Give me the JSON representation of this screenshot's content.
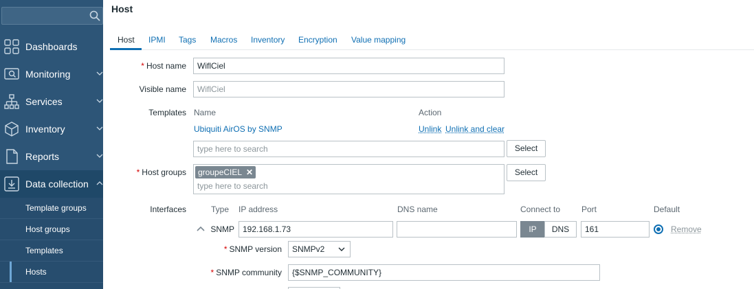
{
  "sidebar": {
    "search_placeholder": "",
    "items": [
      {
        "label": "Dashboards",
        "icon": "dashboard-icon"
      },
      {
        "label": "Monitoring",
        "icon": "monitoring-icon"
      },
      {
        "label": "Services",
        "icon": "services-icon"
      },
      {
        "label": "Inventory",
        "icon": "inventory-icon"
      },
      {
        "label": "Reports",
        "icon": "reports-icon"
      },
      {
        "label": "Data collection",
        "icon": "data-collection-icon"
      }
    ],
    "subitems": [
      {
        "label": "Template groups"
      },
      {
        "label": "Host groups"
      },
      {
        "label": "Templates"
      },
      {
        "label": "Hosts"
      }
    ]
  },
  "page": {
    "title": "Host"
  },
  "tabs": [
    "Host",
    "IPMI",
    "Tags",
    "Macros",
    "Inventory",
    "Encryption",
    "Value mapping"
  ],
  "form": {
    "host_name": {
      "label": "Host name",
      "value": "WiflCiel"
    },
    "visible_name": {
      "label": "Visible name",
      "placeholder": "WiflCiel"
    },
    "templates": {
      "label": "Templates",
      "col_name": "Name",
      "col_action": "Action",
      "linked": "Ubiquiti AirOS by SNMP",
      "unlink": "Unlink",
      "unlink_clear": "Unlink and clear",
      "search_placeholder": "type here to search",
      "select_label": "Select"
    },
    "host_groups": {
      "label": "Host groups",
      "chip": "groupeCIEL",
      "search_placeholder": "type here to search",
      "select_label": "Select"
    },
    "interfaces": {
      "label": "Interfaces",
      "col_type": "Type",
      "col_ip": "IP address",
      "col_dns": "DNS name",
      "col_connect": "Connect to",
      "col_port": "Port",
      "col_default": "Default",
      "type": "SNMP",
      "ip": "192.168.1.73",
      "dns": "",
      "connect_ip": "IP",
      "connect_dns": "DNS",
      "port": "161",
      "remove": "Remove",
      "snmp_version_label": "SNMP version",
      "snmp_version": "SNMPv2",
      "snmp_community_label": "SNMP community",
      "snmp_community": "{$SNMP_COMMUNITY}"
    }
  },
  "colors": {
    "sidebar": "#2d5577",
    "accent": "#0f6fb3",
    "required": "#d40000"
  }
}
